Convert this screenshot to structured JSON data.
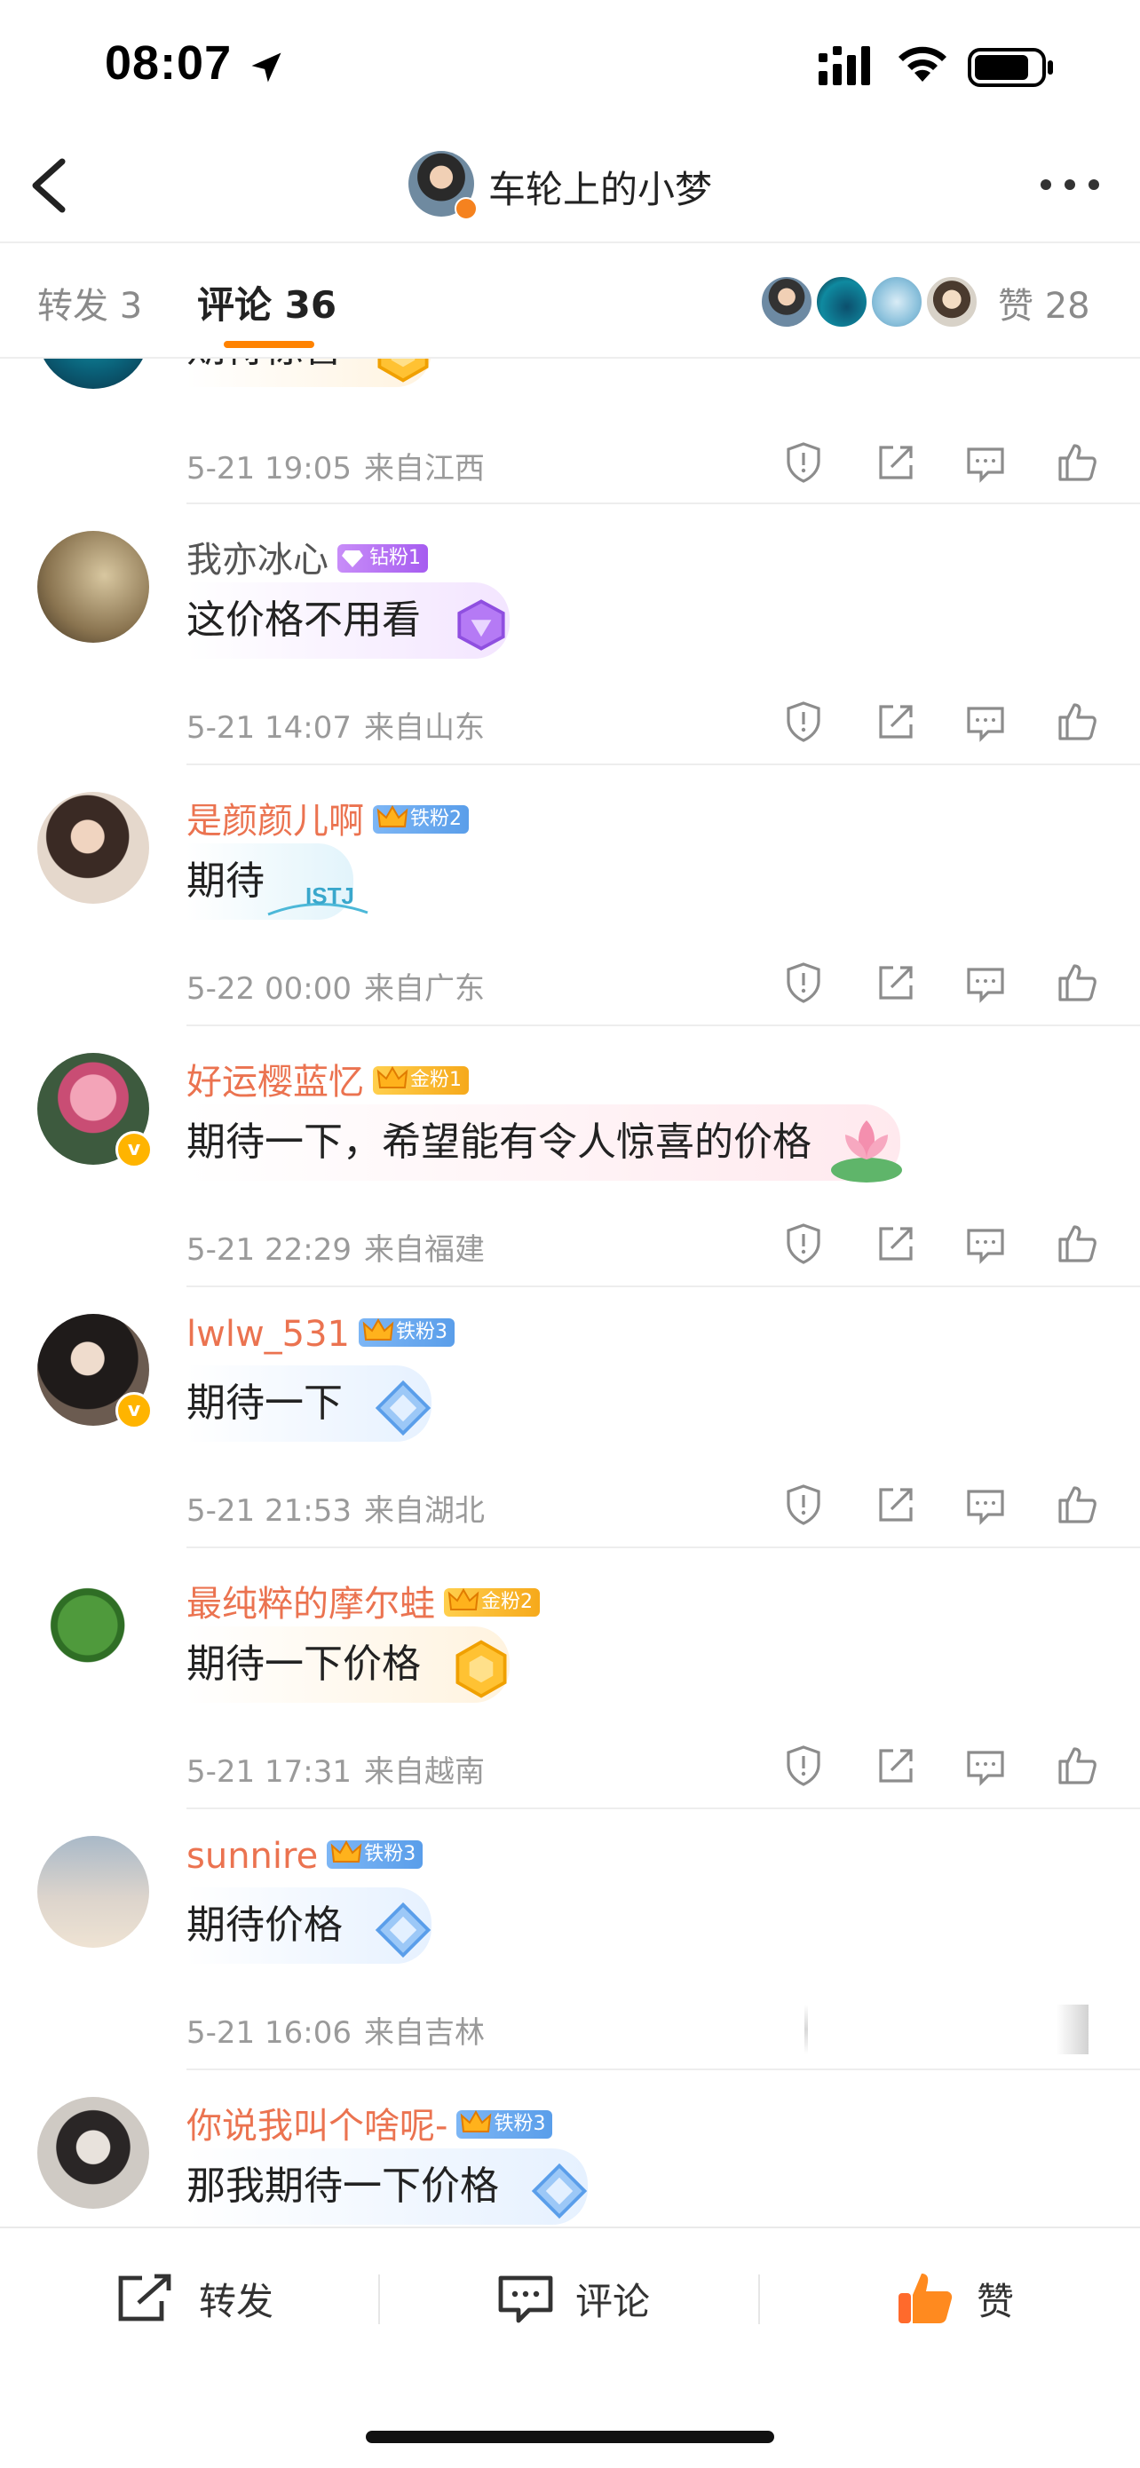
{
  "status_bar": {
    "time": "08:07"
  },
  "nav": {
    "title": "车轮上的小梦"
  },
  "tabs": {
    "repost": "转发 3",
    "comments": "评论 36",
    "likes": "赞 28"
  },
  "comments": [
    {
      "text": "期待惊喜",
      "time": "5-21 19:05",
      "location": "来自江西"
    },
    {
      "username": "我亦冰心",
      "badge": "钻粉1",
      "text": "这价格不用看",
      "time": "5-21 14:07",
      "location": "来自山东"
    },
    {
      "username": "是颜颜儿啊",
      "badge": "铁粉2",
      "text": "期待",
      "time": "5-22 00:00",
      "location": "来自广东"
    },
    {
      "username": "好运樱蓝忆",
      "badge": "金粉1",
      "text": "期待一下，希望能有令人惊喜的价格",
      "time": "5-21 22:29",
      "location": "来自福建"
    },
    {
      "username": "lwlw_531",
      "badge": "铁粉3",
      "text": "期待一下",
      "time": "5-21 21:53",
      "location": "来自湖北"
    },
    {
      "username": "最纯粹的摩尔蛙",
      "badge": "金粉2",
      "text": "期待一下价格",
      "time": "5-21 17:31",
      "location": "来自越南"
    },
    {
      "username": "sunnire",
      "badge": "铁粉3",
      "text": "期待价格",
      "time": "5-21 16:06",
      "location": "来自吉林"
    },
    {
      "username": "你说我叫个啥呢-",
      "badge": "铁粉3",
      "text": "那我期待一下价格"
    }
  ],
  "deco_stickers": {
    "istj": "ISTJ"
  },
  "bottom_bar": {
    "repost": "转发",
    "comment": "评论",
    "like": "赞"
  },
  "colors": {
    "accent": "#ff8200",
    "username_highlight": "#eb7350",
    "meta": "#9a9a9a"
  }
}
